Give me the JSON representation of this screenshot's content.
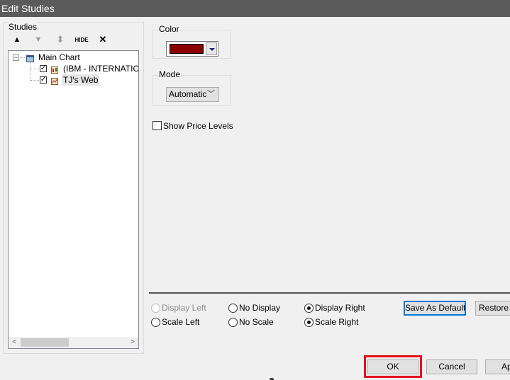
{
  "window": {
    "title": "Edit Studies"
  },
  "studies": {
    "label": "Studies",
    "toolbar": {
      "up_label": "▲",
      "down_label": "▼",
      "move_label": "⬍",
      "hide_label": "HIDE",
      "delete_label": "✕"
    },
    "tree": {
      "root": {
        "label": "Main Chart",
        "expander": "−"
      },
      "items": [
        {
          "label": "(IBM - INTERNATIONA",
          "checked": true
        },
        {
          "label": "TJ's Web",
          "checked": true
        }
      ]
    },
    "scroll": {
      "left": "<",
      "right": ">"
    }
  },
  "color": {
    "label": "Color",
    "value": "#8b0000"
  },
  "mode": {
    "label": "Mode",
    "value": "Automatic"
  },
  "show_price_levels": {
    "label": "Show Price Levels",
    "checked": false
  },
  "display_options": {
    "display_left": "Display Left",
    "no_display": "No Display",
    "display_right": "Display Right",
    "scale_left": "Scale Left",
    "no_scale": "No Scale",
    "scale_right": "Scale Right"
  },
  "buttons": {
    "save_as_default": "Save As Default",
    "restore_default": "Restore De",
    "ok": "OK",
    "cancel": "Cancel",
    "apply": "Ap"
  }
}
